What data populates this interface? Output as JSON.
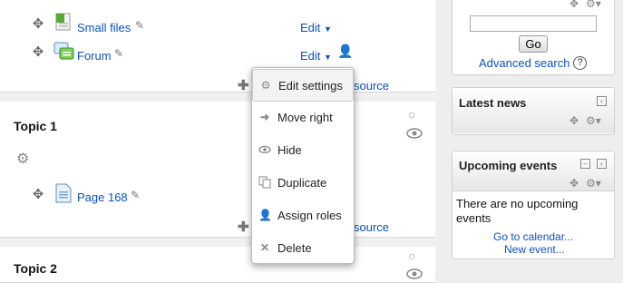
{
  "section0": {
    "activities": [
      {
        "name": "Small files",
        "icon": "folder-file-icon",
        "edit_label": "Edit"
      },
      {
        "name": "Forum",
        "icon": "forum-icon",
        "edit_label": "Edit"
      }
    ],
    "add_resource_partial": "source"
  },
  "topic1": {
    "title": "Topic 1",
    "activities": [
      {
        "name": "Page 168",
        "icon": "page-icon"
      }
    ],
    "add_resource_partial": "source"
  },
  "topic2": {
    "title": "Topic 2"
  },
  "edit_menu": {
    "items": [
      {
        "label": "Edit settings",
        "icon": "gear-icon"
      },
      {
        "label": "Move right",
        "icon": "arrow-right-icon"
      },
      {
        "label": "Hide",
        "icon": "eye-icon"
      },
      {
        "label": "Duplicate",
        "icon": "duplicate-icon"
      },
      {
        "label": "Assign roles",
        "icon": "assign-roles-icon"
      },
      {
        "label": "Delete",
        "icon": "delete-icon"
      }
    ]
  },
  "search_block": {
    "input_value": "",
    "go_label": "Go",
    "advanced_label": "Advanced search"
  },
  "news_block": {
    "title": "Latest news"
  },
  "events_block": {
    "title": "Upcoming events",
    "empty_text": "There are no upcoming events",
    "calendar_link": "Go to calendar...",
    "new_event_link": "New event..."
  },
  "colors": {
    "link": "#0a50c8",
    "background": "#eeeeee"
  }
}
